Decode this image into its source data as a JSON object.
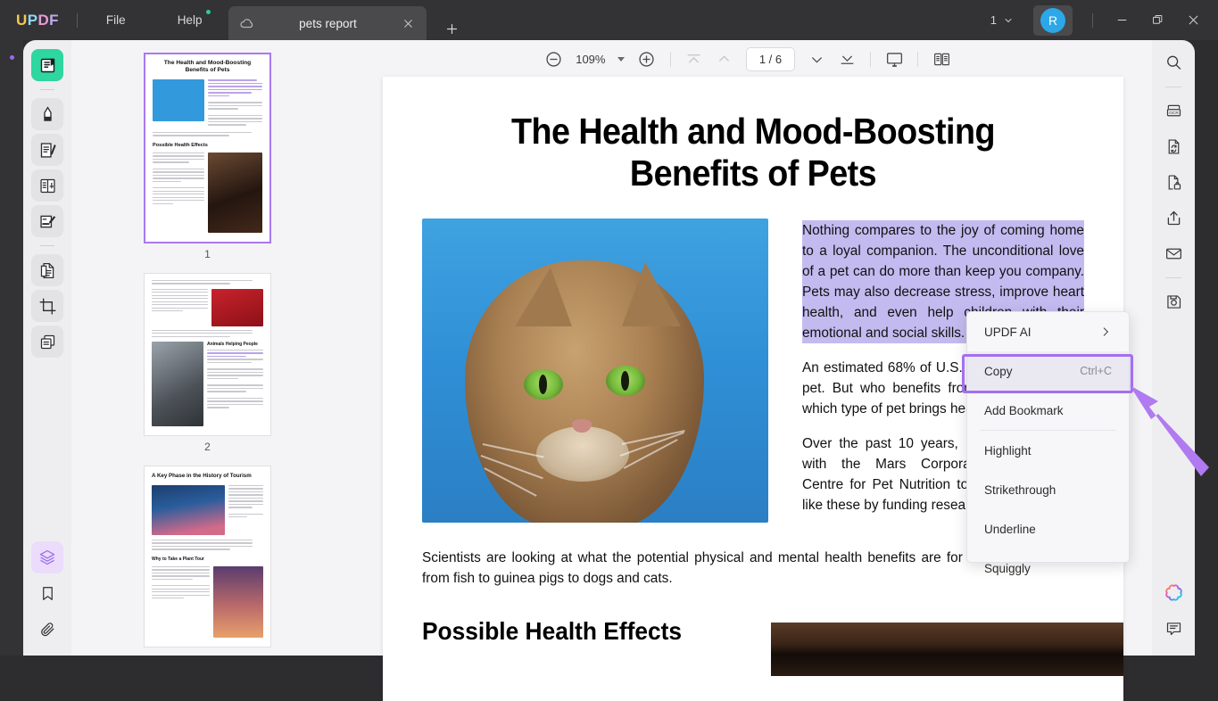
{
  "titlebar": {
    "logo_parts": [
      "U",
      "P",
      "D",
      "F"
    ],
    "menus": [
      {
        "label": "File",
        "badge": false
      },
      {
        "label": "Help",
        "badge": true
      }
    ],
    "tab": {
      "title": "pets report",
      "cloud_icon": "cloud-icon",
      "close_icon": "close-icon"
    },
    "new_tab_label": "+",
    "window_count": "1",
    "avatar_initial": "R",
    "minimize_label": "—",
    "maximize_icon": "restore-icon",
    "close_label": "✕"
  },
  "left_tools": [
    {
      "name": "reader-tool",
      "icon": "book-reader-icon",
      "active": true
    },
    {
      "name": "highlighter-tool",
      "icon": "marker-pen-icon",
      "active": false
    },
    {
      "name": "edit-pdf-tool",
      "icon": "edit-document-icon",
      "active": false
    },
    {
      "name": "organize-pages-tool",
      "icon": "page-organize-icon",
      "active": false
    },
    {
      "name": "annotate-tool",
      "icon": "annotate-pen-icon",
      "active": false
    },
    {
      "name": "convert-pdf-tool",
      "icon": "convert-file-icon",
      "active": false
    },
    {
      "name": "crop-tool",
      "icon": "crop-icon",
      "active": false
    },
    {
      "name": "batch-tool",
      "icon": "batch-pages-icon",
      "active": false
    }
  ],
  "left_tools_bottom": [
    {
      "name": "layers-panel",
      "icon": "layers-icon",
      "active": true
    },
    {
      "name": "bookmarks-panel",
      "icon": "bookmark-icon",
      "active": false
    },
    {
      "name": "attachments-panel",
      "icon": "paperclip-icon",
      "active": false
    }
  ],
  "doc_toolbar": {
    "zoom_out": "zoom-out-icon",
    "zoom_level": "109%",
    "zoom_dropdown": "chevron-down-icon",
    "zoom_in": "zoom-in-icon",
    "first_page": "first-page-icon",
    "prev_page": "prev-page-icon",
    "page_indicator": "1 / 6",
    "next_page": "next-page-icon",
    "last_page": "last-page-icon",
    "presentation": "presentation-icon",
    "view_mode": "dual-page-view-icon"
  },
  "thumbnails": [
    {
      "number": "1",
      "selected": true,
      "title": "The Health and Mood-Boosting Benefits of Pets",
      "subhead": "Possible Health Effects"
    },
    {
      "number": "2",
      "selected": false,
      "title": "",
      "subhead": "Animals Helping People"
    },
    {
      "number": "3",
      "selected": false,
      "title": "A Key Phase in the History of Tourism",
      "subhead": "Why to Take a Plant Tour"
    }
  ],
  "document": {
    "title": "The Health and Mood-Boosting Benefits of Pets",
    "selected_paragraph": "Nothing compares to the joy of coming home to a loyal companion. The unconditional love of a pet can do more than keep you company. Pets may also decrease stress, improve heart health, and even help children with their emotional and social skills.",
    "paragraph2": "An estimated 68% of U.S. households have a pet. But who benefits from an animal? And which type of pet brings health benefits?",
    "paragraph3": "Over the past 10 years, NIH has partnered with the Mars Corporation's WALTHAM Centre for Pet Nutrition to answer questions like these by funding research studies.",
    "paragraph4": "Scientists are looking at what the potential physical and mental health benefits are for different animals—from fish to guinea pigs to dogs and cats.",
    "section_heading": "Possible Health Effects",
    "hero_image_alt": "tabby-cat-on-blue-background"
  },
  "context_menu": {
    "items": [
      {
        "label": "UPDF AI",
        "shortcut": "",
        "submenu": true,
        "highlighted": false
      },
      {
        "label": "Copy",
        "shortcut": "Ctrl+C",
        "submenu": false,
        "highlighted": true
      },
      {
        "label": "Add Bookmark",
        "shortcut": "",
        "submenu": false,
        "highlighted": false
      },
      {
        "label": "Highlight",
        "shortcut": "",
        "submenu": false,
        "highlighted": false
      },
      {
        "label": "Strikethrough",
        "shortcut": "",
        "submenu": false,
        "highlighted": false
      },
      {
        "label": "Underline",
        "shortcut": "",
        "submenu": false,
        "highlighted": false
      },
      {
        "label": "Squiggly",
        "shortcut": "",
        "submenu": false,
        "highlighted": false
      }
    ],
    "highlight_color": "#a36ff0",
    "annotation_arrow_color": "#b07af0"
  },
  "right_tools": [
    {
      "name": "search-tool",
      "icon": "search-icon"
    },
    {
      "name": "ocr-tool",
      "icon": "ocr-icon"
    },
    {
      "name": "convert-tool",
      "icon": "file-convert-icon"
    },
    {
      "name": "protect-tool",
      "icon": "file-lock-icon"
    },
    {
      "name": "share-tool",
      "icon": "share-upload-icon"
    },
    {
      "name": "email-tool",
      "icon": "envelope-icon"
    },
    {
      "name": "save-tool",
      "icon": "floppy-save-icon"
    }
  ],
  "right_tools_bottom": [
    {
      "name": "ai-assistant",
      "icon": "ai-clover-icon"
    },
    {
      "name": "comments-panel",
      "icon": "comment-bubble-icon"
    }
  ],
  "colors": {
    "accent_purple": "#a36ff0",
    "selection_highlight": "#c3bbf0",
    "active_tool_green": "#2ed6a0",
    "avatar_blue": "#2ca7e8",
    "titlebar_bg": "#333336",
    "panel_bg": "#eeeef0"
  }
}
